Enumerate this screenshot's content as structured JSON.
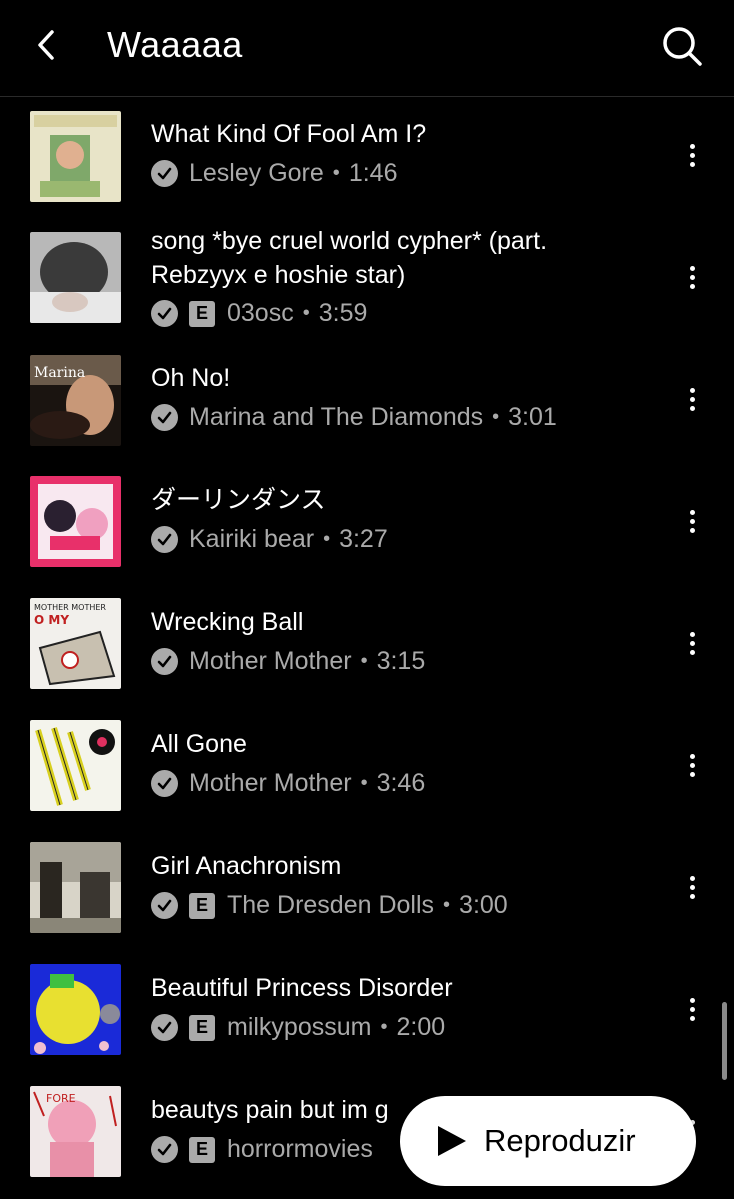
{
  "header": {
    "title": "Waaaaa"
  },
  "songs": [
    {
      "title": "What Kind Of Fool Am I?",
      "artist": "Lesley Gore",
      "duration": "1:46",
      "explicit": false
    },
    {
      "title": "song *bye cruel world cypher* (part. Rebzyyx e hoshie star)",
      "artist": "03osc",
      "duration": "3:59",
      "explicit": true
    },
    {
      "title": "Oh No!",
      "artist": "Marina and The Diamonds",
      "duration": "3:01",
      "explicit": false
    },
    {
      "title": "ダーリンダンス",
      "artist": "Kairiki bear",
      "duration": "3:27",
      "explicit": false
    },
    {
      "title": "Wrecking Ball",
      "artist": "Mother Mother",
      "duration": "3:15",
      "explicit": false
    },
    {
      "title": "All Gone",
      "artist": "Mother Mother",
      "duration": "3:46",
      "explicit": false
    },
    {
      "title": "Girl Anachronism",
      "artist": "The Dresden Dolls",
      "duration": "3:00",
      "explicit": true
    },
    {
      "title": "Beautiful Princess Disorder",
      "artist": "milkypossum",
      "duration": "2:00",
      "explicit": true
    },
    {
      "title": "beautys pain but im g",
      "artist": "horrormovies",
      "duration": "",
      "explicit": true
    }
  ],
  "explicit_label": "E",
  "separator": "•",
  "play_button": {
    "label": "Reproduzir"
  },
  "colors": {
    "background": "#000000",
    "secondary_text": "#aaaaaa",
    "play_button": "#ffffff"
  }
}
